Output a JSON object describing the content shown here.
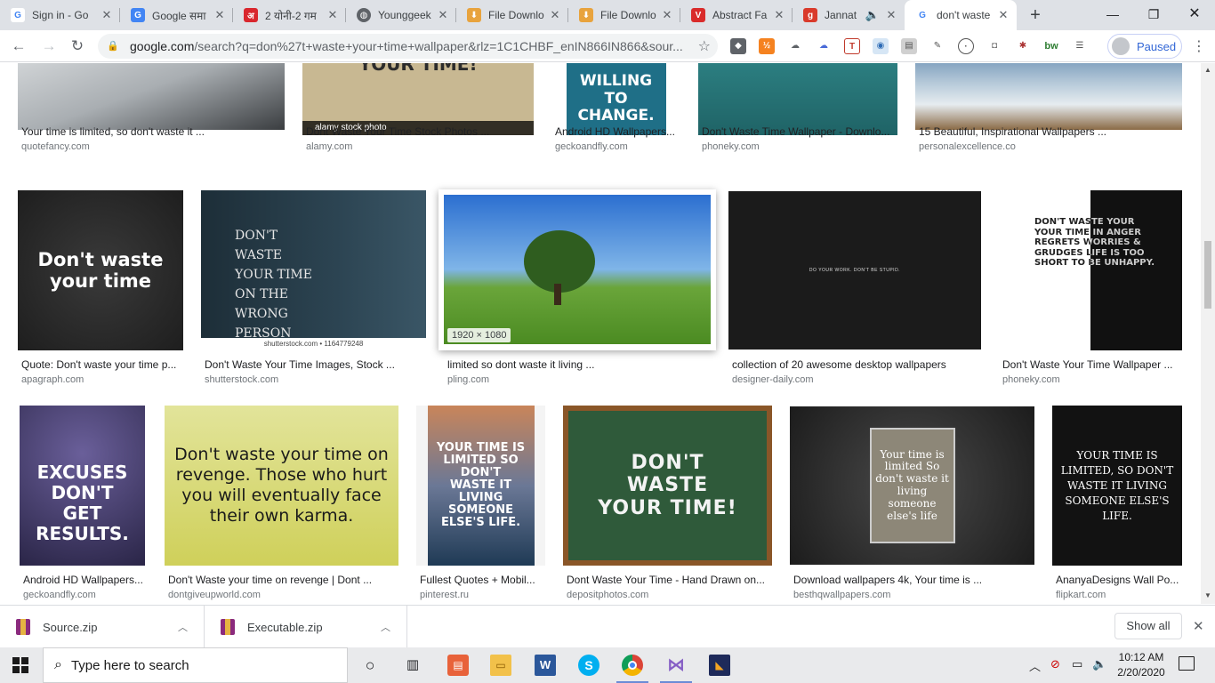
{
  "tabs": [
    {
      "title": "Sign in - Go",
      "favicon": "google-g-icon",
      "color": "#4285f4",
      "glyph": "G"
    },
    {
      "title": "Google समा",
      "favicon": "google-translate-icon",
      "color": "#4285f4",
      "glyph": "G"
    },
    {
      "title": "2 योनी-2 गम",
      "favicon": "amar-ujala-icon",
      "color": "#d9272e",
      "glyph": "अ"
    },
    {
      "title": "Younggeek",
      "favicon": "globe-icon",
      "color": "#5f6368",
      "glyph": "◍"
    },
    {
      "title": "File Downlo",
      "favicon": "file-download-icon",
      "color": "#e8a33d",
      "glyph": "⬇"
    },
    {
      "title": "File Downlo",
      "favicon": "file-download-icon",
      "color": "#e8a33d",
      "glyph": "⬇"
    },
    {
      "title": "Abstract Fa",
      "favicon": "vivaldi-v-icon",
      "color": "#d92b2b",
      "glyph": "V"
    },
    {
      "title": "Jannat",
      "favicon": "g-red-icon",
      "color": "#d93a2b",
      "glyph": "g"
    },
    {
      "title": "don't waste",
      "favicon": "google-g-icon",
      "color": "#4285f4",
      "glyph": "G"
    }
  ],
  "toolbar": {
    "url_domain": "google.com",
    "url_path": "/search?q=don%27t+waste+your+time+wallpaper&rlz=1C1CHBF_enIN866IN866&sour...",
    "profile_label": "Paused"
  },
  "results": {
    "row1": [
      {
        "caption": "Your time is limited, so don't waste it ...",
        "source": "quotefancy.com",
        "img_text": "",
        "bg": "#b9bec1"
      },
      {
        "caption": "Dont Waste Your Time Stock Photos ...",
        "source": "alamy.com",
        "img_text": "YOUR TIME!",
        "watermark": "alamy stock photo",
        "bg": "#c8b892"
      },
      {
        "caption": "Android HD Wallpapers...",
        "source": "geckoandfly.com",
        "img_text": "WILLING TO CHANGE.",
        "bg": "#1f6f87"
      },
      {
        "caption": "Don't Waste Time Wallpaper - Downlo...",
        "source": "phoneky.com",
        "img_text": "",
        "bg": "#2d7c7e"
      },
      {
        "caption": "15 Beautiful, Inspirational Wallpapers ...",
        "source": "personalexcellence.co",
        "img_text": "",
        "bg": "#7a99b5"
      }
    ],
    "row2": [
      {
        "caption": "Quote: Don't waste your time p...",
        "source": "apagraph.com",
        "img_text": "Don't waste your time",
        "bg": "#2b2b2b"
      },
      {
        "caption": "Don't Waste Your Time Images, Stock ...",
        "source": "shutterstock.com",
        "img_text": "DON'T WASTE YOUR TIME ON THE WRONG PERSON",
        "watermark": "shutterstock.com • 1164779248",
        "bg": "#22323c"
      },
      {
        "caption": "limited so dont waste it living ...",
        "source": "pling.com",
        "img_text": "",
        "badge": "1920 × 1080",
        "bg": "#4c8fd6"
      },
      {
        "caption": "collection of 20 awesome desktop wallpapers",
        "source": "designer-daily.com",
        "img_text": "DO YOUR WORK. DON'T BE STUPID.",
        "bg": "#1b1b1b"
      },
      {
        "caption": "Don't Waste Your Time Wallpaper ...",
        "source": "phoneky.com",
        "img_text": "DON'T WASTE YOUR YOUR TIME IN ANGER REGRETS WORRIES & GRUDGES LIFE IS TOO SHORT TO BE UNHAPPY.",
        "bg": "#ffffff"
      }
    ],
    "row3": [
      {
        "caption": "Android HD Wallpapers...",
        "source": "geckoandfly.com",
        "img_text": "EXCUSES DON'T GET RESULTS.",
        "bg": "#3b3560"
      },
      {
        "caption": "Don't Waste your time on revenge | Dont ...",
        "source": "dontgiveupworld.com",
        "img_text": "Don't waste your time on revenge. Those who hurt you will eventually face their own karma.",
        "bg": "#dfe08a"
      },
      {
        "caption": "Fullest Quotes + Mobil...",
        "source": "pinterest.ru",
        "img_text": "YOUR TIME IS LIMITED SO DON'T WASTE IT LIVING SOMEONE ELSE'S LIFE.",
        "bg": "#3a5068"
      },
      {
        "caption": "Dont Waste Your Time - Hand Drawn on...",
        "source": "depositphotos.com",
        "img_text": "DON'T WASTE YOUR TIME!",
        "bg": "#2f5a3a"
      },
      {
        "caption": "Download wallpapers 4k, Your time is ...",
        "source": "besthqwallpapers.com",
        "img_text": "Your time is limited So don't waste it living someone else's life",
        "bg": "#2c2c2c"
      },
      {
        "caption": "AnanyaDesigns Wall Po...",
        "source": "flipkart.com",
        "img_text": "YOUR TIME IS LIMITED, SO DON'T WASTE IT LIVING SOMEONE ELSE'S LIFE.",
        "bg": "#121212"
      }
    ]
  },
  "downloads": [
    {
      "name": "Source.zip"
    },
    {
      "name": "Executable.zip"
    }
  ],
  "shelf": {
    "show_all": "Show all"
  },
  "taskbar": {
    "search_placeholder": "Type here to search",
    "time": "10:12 AM",
    "date": "2/20/2020"
  }
}
